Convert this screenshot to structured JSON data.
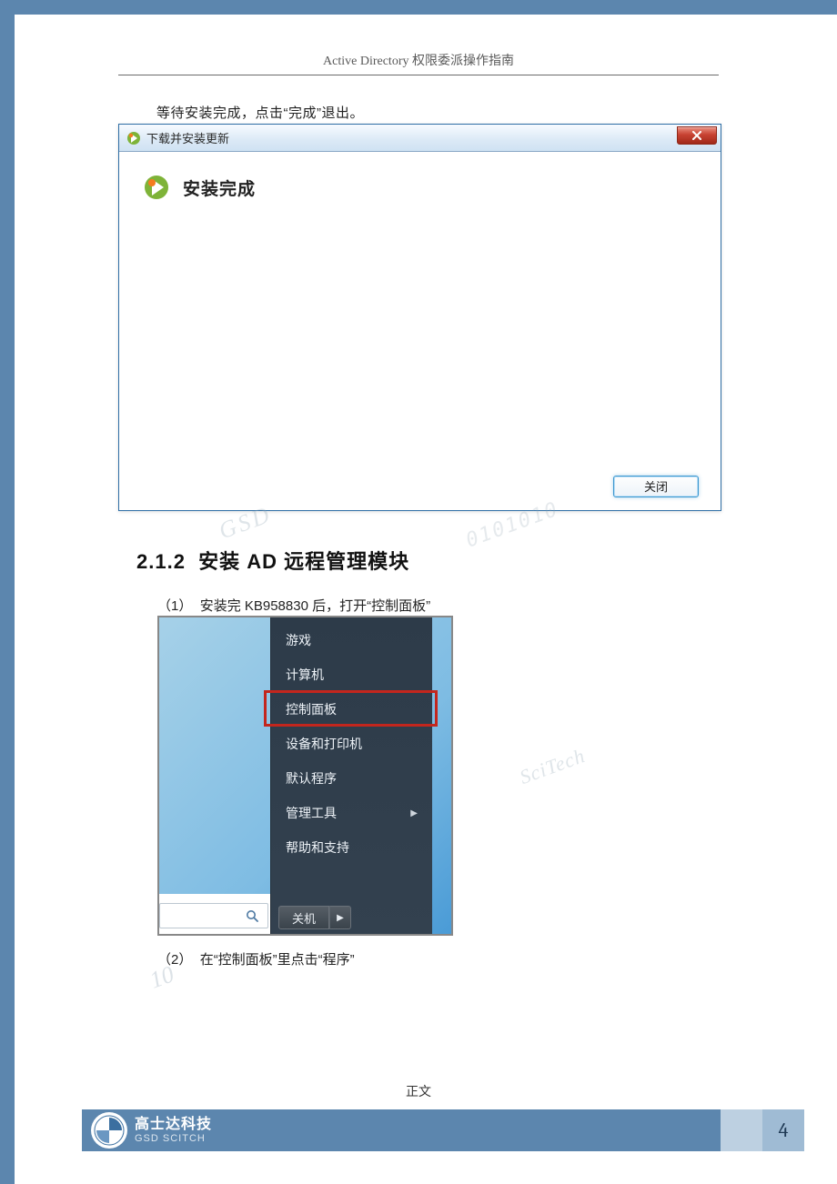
{
  "header": {
    "title": "Active Directory 权限委派操作指南"
  },
  "intro_text": "等待安装完成，点击“完成”退出。",
  "dialog": {
    "title": "下载并安装更新",
    "status": "安装完成",
    "close_button": "关闭"
  },
  "section": {
    "number": "2.1.2",
    "title": "安装 AD 远程管理模块"
  },
  "steps": {
    "step1_num": "（1）",
    "step1_text": "安装完 KB958830 后，打开“控制面板”",
    "step2_num": "（2）",
    "step2_text": "在“控制面板”里点击“程序”"
  },
  "start_menu": {
    "items": [
      "游戏",
      "计算机",
      "控制面板",
      "设备和打印机",
      "默认程序",
      "管理工具",
      "帮助和支持"
    ],
    "highlighted_index": 2,
    "arrow_index": 5,
    "shutdown": "关机"
  },
  "watermarks": {
    "a": "GSD",
    "b": "0101010",
    "c": "SciTech",
    "d": "10"
  },
  "footer": {
    "section_label": "正文",
    "company_cn": "高士达科技",
    "company_en": "GSD SCITCH",
    "page_number": "4"
  }
}
